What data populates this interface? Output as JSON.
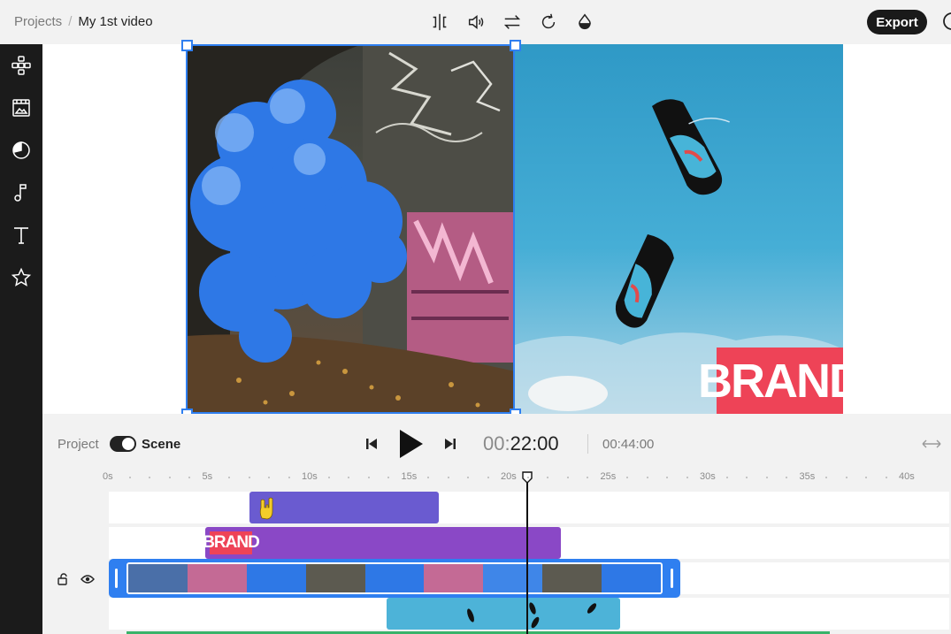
{
  "breadcrumb": {
    "parent": "Projects",
    "separator": "/",
    "current": "My 1st video"
  },
  "toolbar": {
    "tools": [
      "split-icon",
      "volume-icon",
      "swap-icon",
      "rotate-icon",
      "color-drop-icon"
    ],
    "export_label": "Export"
  },
  "sidebar": {
    "items": [
      "elements-icon",
      "media-icon",
      "stickers-icon",
      "music-icon",
      "text-icon",
      "star-icon"
    ]
  },
  "preview": {
    "brand_text": "BRAND"
  },
  "playback": {
    "mode_project": "Project",
    "mode_scene": "Scene",
    "mode_selected": "Scene",
    "time_dim": "00:",
    "time_main": "22:00",
    "duration": "00:44:00"
  },
  "timeline": {
    "ticks": [
      "0s",
      "5s",
      "10s",
      "15s",
      "20s",
      "25s",
      "30s",
      "35s",
      "40s"
    ],
    "playhead_seconds": 21,
    "brand_thumb_text": "BRAND",
    "colors": {
      "accent": "#2f7ff0",
      "emoji_clip": "#6a5bd0",
      "brand_clip": "#8a48c6",
      "brand": "#ee4357",
      "audio": "#39b36a"
    }
  }
}
